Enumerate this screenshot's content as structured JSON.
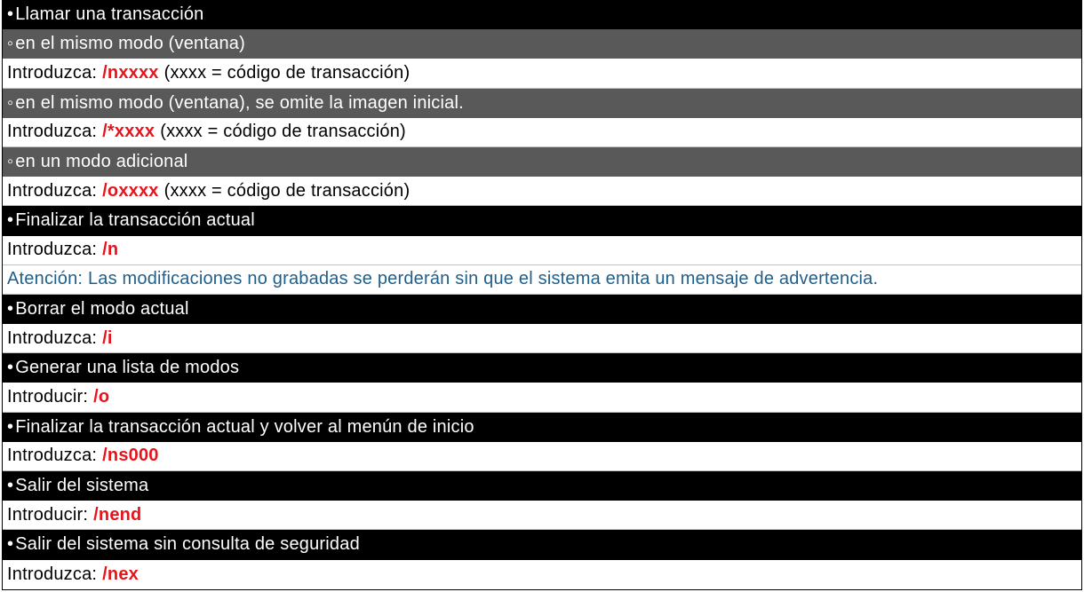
{
  "rows": [
    {
      "style": "black",
      "bullet": "•",
      "text": "Llamar una transacción"
    },
    {
      "style": "gray",
      "bullet": "◦",
      "text": "en el mismo modo (ventana)"
    },
    {
      "style": "white",
      "label": "Introduzca:",
      "command": "/nxxxx",
      "suffix": "(xxxx = código de transacción)"
    },
    {
      "style": "gray",
      "bullet": "◦",
      "text": "en el mismo modo (ventana), se omite la imagen inicial."
    },
    {
      "style": "white",
      "label": "Introduzca:",
      "command": "/*xxxx",
      "suffix": "(xxxx = código de transacción)"
    },
    {
      "style": "gray",
      "bullet": "◦",
      "text": "en un modo adicional"
    },
    {
      "style": "white",
      "label": "Introduzca:",
      "command": "/oxxxx",
      "suffix": "(xxxx = código de transacción)"
    },
    {
      "style": "black",
      "bullet": "•",
      "text": "Finalizar la transacción actual"
    },
    {
      "style": "white",
      "label": "Introduzca:",
      "command": "/n",
      "suffix": ""
    },
    {
      "style": "note",
      "text": "Atención: Las modificaciones no grabadas se perderán sin que el sistema emita un mensaje de advertencia."
    },
    {
      "style": "black",
      "bullet": "•",
      "text": "Borrar el modo actual"
    },
    {
      "style": "white",
      "label": "Introduzca:",
      "command": "/i",
      "suffix": ""
    },
    {
      "style": "black",
      "bullet": "•",
      "text": "Generar una lista de modos"
    },
    {
      "style": "white",
      "label": "Introducir:",
      "command": "/o",
      "suffix": ""
    },
    {
      "style": "black",
      "bullet": "•",
      "text": "Finalizar la transacción actual y volver al menún de inicio"
    },
    {
      "style": "white",
      "label": "Introduzca:",
      "command": "/ns000",
      "suffix": ""
    },
    {
      "style": "black",
      "bullet": "•",
      "text": "Salir del sistema"
    },
    {
      "style": "white",
      "label": "Introducir:",
      "command": "/nend",
      "suffix": ""
    },
    {
      "style": "black",
      "bullet": "•",
      "text": "Salir del sistema sin consulta de seguridad"
    },
    {
      "style": "white",
      "label": "Introduzca:",
      "command": "/nex",
      "suffix": ""
    }
  ],
  "colors": {
    "heading_bg": "#000000",
    "subheading_bg": "#595959",
    "command_red": "#e8141b",
    "note_blue": "#1f5f8b"
  }
}
